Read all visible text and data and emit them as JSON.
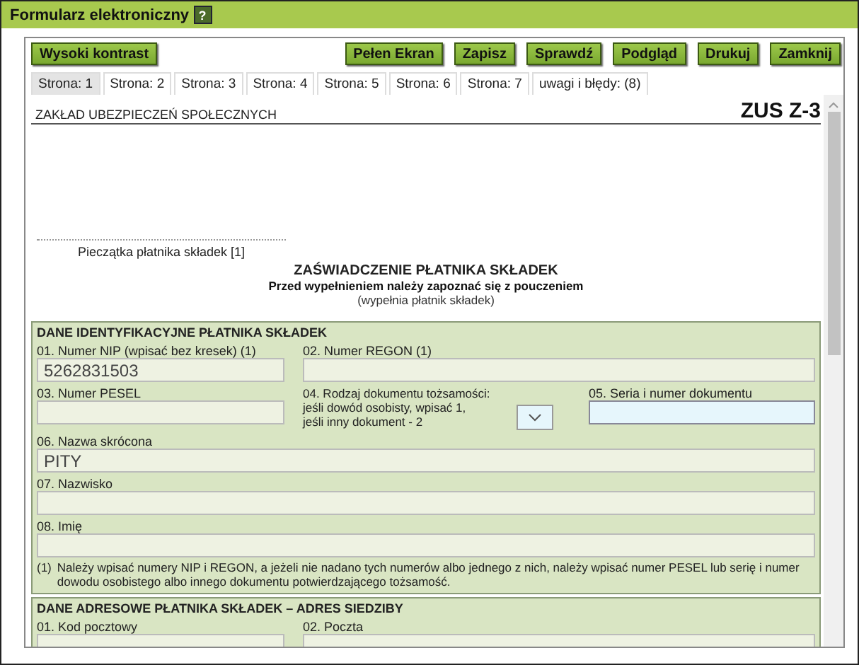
{
  "window": {
    "title": "Formularz elektroniczny",
    "help_icon": "?"
  },
  "toolbar": {
    "left": [
      "Wysoki kontrast"
    ],
    "right": [
      "Pełen Ekran",
      "Zapisz",
      "Sprawdź",
      "Podgląd",
      "Drukuj",
      "Zamknij"
    ]
  },
  "tabs": [
    {
      "label": "Strona: 1",
      "selected": true
    },
    {
      "label": "Strona: 2",
      "selected": false
    },
    {
      "label": "Strona: 3",
      "selected": false
    },
    {
      "label": "Strona: 4",
      "selected": false
    },
    {
      "label": "Strona: 5",
      "selected": false
    },
    {
      "label": "Strona: 6",
      "selected": false
    },
    {
      "label": "Strona: 7",
      "selected": false
    },
    {
      "label": "uwagi i błędy: (8)",
      "selected": false
    }
  ],
  "document": {
    "institution": "ZAKŁAD UBEZPIECZEŃ SPOŁECZNYCH",
    "form_code": "ZUS Z-3",
    "stamp_label": "Pieczątka płatnika składek [1]",
    "title": "ZAŚWIADCZENIE PŁATNIKA SKŁADEK",
    "subtitle": "Przed wypełnieniem należy zapoznać się z pouczeniem",
    "note": "(wypełnia płatnik składek)"
  },
  "section_1": {
    "heading": "DANE IDENTYFIKACYJNE PŁATNIKA SKŁADEK",
    "nip": {
      "label": "01. Numer NIP (wpisać bez kresek) (1)",
      "value": "5262831503"
    },
    "regon": {
      "label": "02. Numer REGON (1)"
    },
    "pesel": {
      "label": "03. Numer PESEL"
    },
    "doc_type": {
      "label_lines": [
        "04. Rodzaj dokumentu tożsamości:",
        "jeśli dowód osobisty, wpisać 1,",
        "jeśli inny dokument - 2"
      ]
    },
    "doc_number": {
      "label": "05. Seria i numer dokumentu"
    },
    "short_name": {
      "label": "06. Nazwa skrócona",
      "value": "PITY"
    },
    "surname": {
      "label": "07. Nazwisko"
    },
    "first_name": {
      "label": "08. Imię"
    },
    "footnote_mark": "(1)",
    "footnote": "Należy wpisać numery NIP i REGON, a jeżeli nie nadano tych numerów albo jednego z nich, należy wpisać numer PESEL lub serię i numer dowodu osobistego albo innego dokumentu potwierdzającego tożsamość."
  },
  "section_2": {
    "heading": "DANE ADRESOWE PŁATNIKA SKŁADEK – ADRES SIEDZIBY",
    "postal_code": {
      "label": "01. Kod pocztowy"
    },
    "post_office": {
      "label": "02. Poczta"
    }
  }
}
